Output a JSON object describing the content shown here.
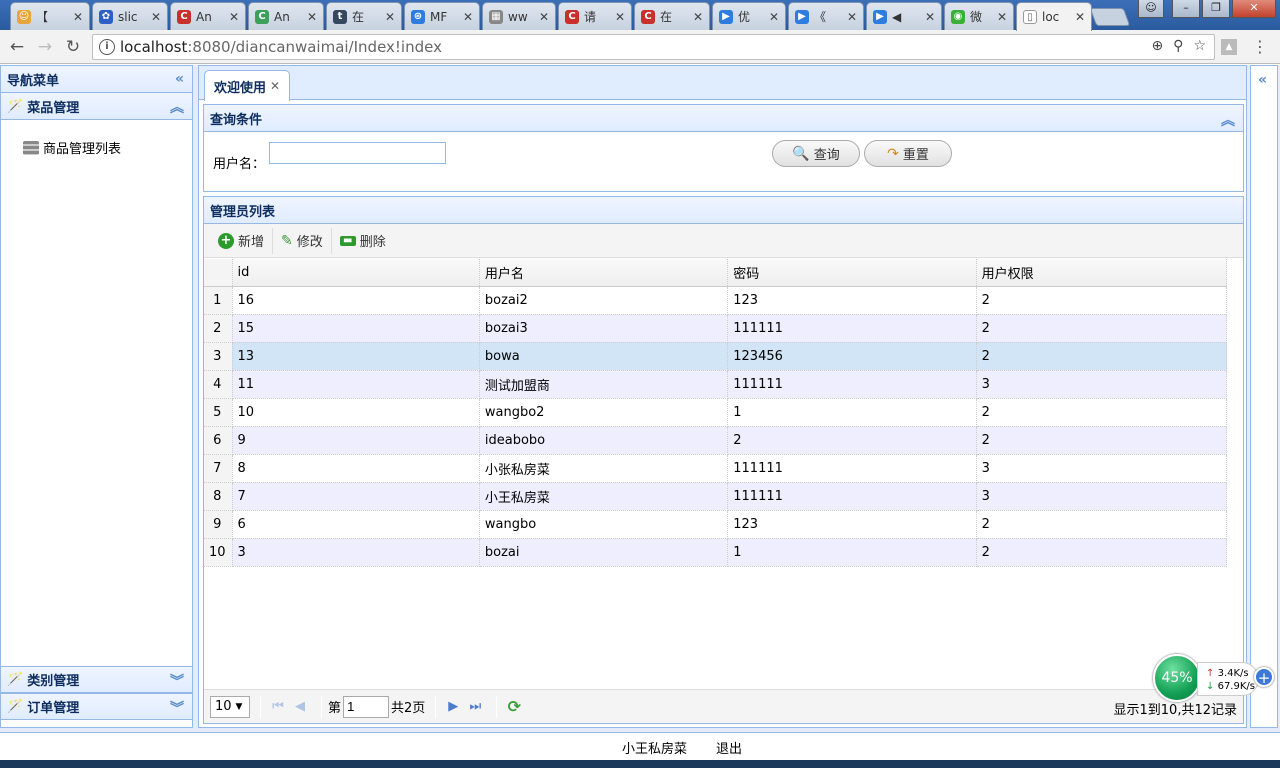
{
  "browser": {
    "tabs": [
      {
        "title": "【",
        "color": "#e8a53b",
        "glyph": "☺"
      },
      {
        "title": "slic",
        "color": "#2d5fc9",
        "glyph": "✿"
      },
      {
        "title": "An",
        "color": "#c9302c",
        "glyph": "C"
      },
      {
        "title": "An",
        "color": "#3aa05a",
        "glyph": "C"
      },
      {
        "title": "在",
        "color": "#36485f",
        "glyph": "t"
      },
      {
        "title": "MF",
        "color": "#2d7de0",
        "glyph": "⊛"
      },
      {
        "title": "ww",
        "color": "#888888",
        "glyph": "▦"
      },
      {
        "title": "请",
        "color": "#c9302c",
        "glyph": "C"
      },
      {
        "title": "在",
        "color": "#c9302c",
        "glyph": "C"
      },
      {
        "title": "优",
        "color": "#2d7de0",
        "glyph": "▶"
      },
      {
        "title": "《",
        "color": "#2d7de0",
        "glyph": "▶"
      },
      {
        "title": "◀",
        "color": "#2d7de0",
        "glyph": "▶"
      },
      {
        "title": "微",
        "color": "#3ab03a",
        "glyph": "◉"
      },
      {
        "title": "loc",
        "color": "#ffffff",
        "glyph": "▯"
      }
    ],
    "url_host": "localhost",
    "url_path": ":8080/diancanwaimai/Index!index"
  },
  "west": {
    "title": "导航菜单",
    "sections": [
      {
        "label": "菜品管理",
        "items": [
          "商品管理列表"
        ]
      },
      {
        "label": "类别管理"
      },
      {
        "label": "订单管理"
      }
    ]
  },
  "center": {
    "tab_label": "欢迎使用",
    "query": {
      "title": "查询条件",
      "username_label": "用户名：",
      "username_value": "",
      "search_label": "查询",
      "reset_label": "重置"
    },
    "grid": {
      "title": "管理员列表",
      "toolbar": {
        "add": "新增",
        "edit": "修改",
        "delete": "删除"
      },
      "columns": [
        "id",
        "用户名",
        "密码",
        "用户权限"
      ],
      "rows": [
        [
          "16",
          "bozai2",
          "123",
          "2"
        ],
        [
          "15",
          "bozai3",
          "111111",
          "2"
        ],
        [
          "13",
          "bowa",
          "123456",
          "2"
        ],
        [
          "11",
          "测试加盟商",
          "111111",
          "3"
        ],
        [
          "10",
          "wangbo2",
          "1",
          "2"
        ],
        [
          "9",
          "ideabobo",
          "2",
          "2"
        ],
        [
          "8",
          "小张私房菜",
          "111111",
          "3"
        ],
        [
          "7",
          "小王私房菜",
          "111111",
          "3"
        ],
        [
          "6",
          "wangbo",
          "123",
          "2"
        ],
        [
          "3",
          "bozai",
          "1",
          "2"
        ]
      ],
      "selected_row": 3,
      "pager": {
        "page_size": "10",
        "page_prefix": "第",
        "page_number": "1",
        "page_suffix": "共2页",
        "info": "显示1到10,共12记录"
      }
    }
  },
  "south": {
    "user": "小王私房菜",
    "logout": "退出"
  },
  "speed_widget": {
    "percent": "45%",
    "up": "3.4K/s",
    "down": "67.9K/s"
  }
}
